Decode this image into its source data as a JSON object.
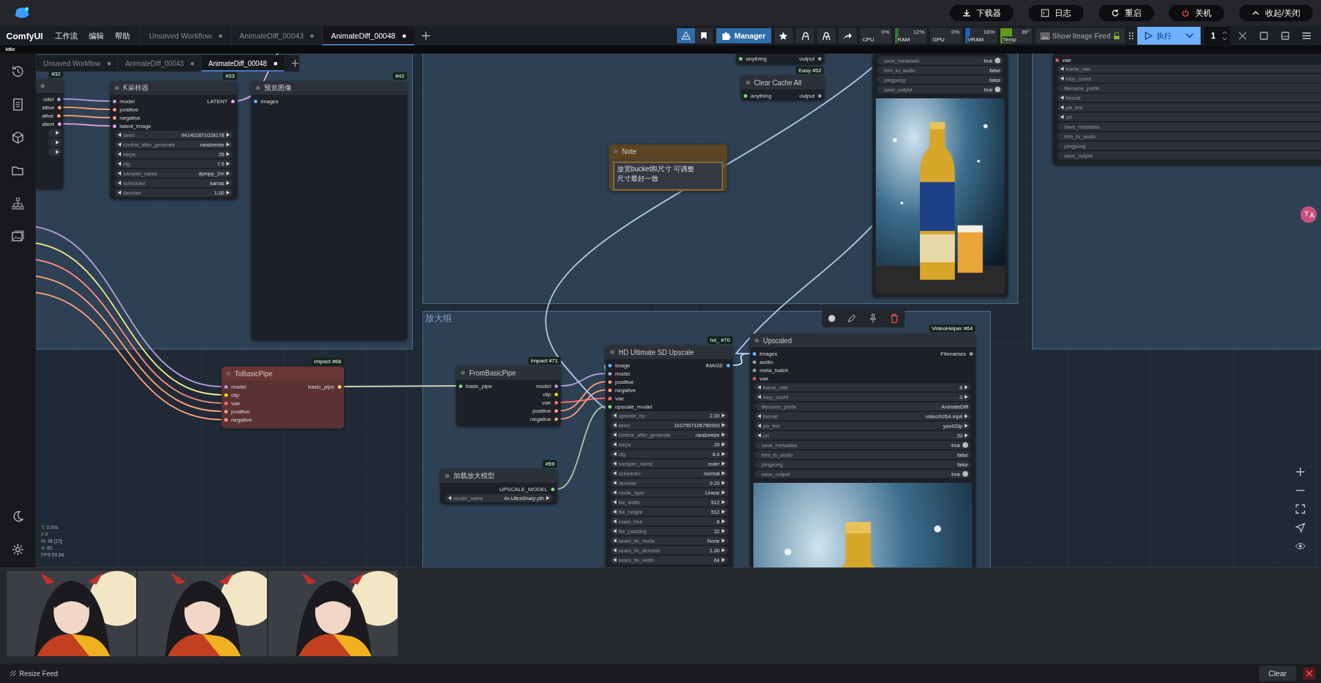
{
  "top_bar": {
    "buttons": [
      {
        "label": "下载器"
      },
      {
        "label": "日志"
      },
      {
        "label": "重启"
      },
      {
        "label": "关机"
      },
      {
        "label": "收起/关闭"
      }
    ]
  },
  "menu": {
    "brand": "ComfyUI",
    "items": [
      "工作流",
      "编辑",
      "帮助"
    ]
  },
  "workflow_tabs": [
    {
      "label": "Unsaved Workflow",
      "selected": false,
      "modified": true
    },
    {
      "label": "AnimateDiff_00043",
      "selected": false,
      "modified": true
    },
    {
      "label": "AnimateDiff_00048",
      "selected": true,
      "modified": true
    }
  ],
  "toolbar": {
    "manager_label": "Manager",
    "monitors": [
      {
        "name": "CPU",
        "reading": "0%"
      },
      {
        "name": "RAM",
        "reading": "12%",
        "level": 0.12,
        "color": "#2e7d32"
      },
      {
        "name": "GPU",
        "reading": "0%"
      },
      {
        "name": "VRAM",
        "reading": "16%",
        "level": 0.16,
        "color": "#1e63b8"
      },
      {
        "name": "Temp",
        "reading": "39°",
        "level": 0.39,
        "color": "#5f9a1c"
      }
    ],
    "image_feed_label": "Show Image Feed",
    "run_label": "执行",
    "queue_count": "1"
  },
  "status": "Idle",
  "canvas_tabs": [
    {
      "label": "Unsaved Workflow",
      "selected": false,
      "modified": true
    },
    {
      "label": "AnimateDiff_00043",
      "selected": false,
      "modified": true
    },
    {
      "label": "AnimateDiff_00048",
      "selected": true,
      "modified": true
    }
  ],
  "group_title": "放大组",
  "nodes": [
    {
      "kind": "node",
      "badge": "#32",
      "outputs": [
        {
          "name": "odel",
          "color": "#b39ddb"
        },
        {
          "name": "sitive",
          "color": "#ffa07a"
        },
        {
          "name": "ative",
          "color": "#ffa07a"
        },
        {
          "name": "atent",
          "color": "#ff9cf9"
        }
      ],
      "widgets": [
        {
          "kind": "stub"
        },
        {
          "kind": "stub"
        },
        {
          "kind": "stub"
        }
      ]
    },
    {
      "kind": "node",
      "title": "K采样器",
      "badge": "#33",
      "inputs": [
        {
          "name": "model",
          "color": "#b39ddb"
        },
        {
          "name": "positive",
          "color": "#ffa07a"
        },
        {
          "name": "negative",
          "color": "#ffa07a"
        },
        {
          "name": "latent_image",
          "color": "#ff9cf9"
        }
      ],
      "outputs": [
        {
          "name": "LATENT",
          "color": "#ff9cf9"
        }
      ],
      "widgets": [
        {
          "kind": "combo",
          "name": "seed",
          "value": "941402871028178"
        },
        {
          "kind": "combo",
          "name": "control_after_generate",
          "value": "randomize"
        },
        {
          "kind": "combo",
          "name": "steps",
          "value": "25"
        },
        {
          "kind": "combo",
          "name": "cfg",
          "value": "7.5"
        },
        {
          "kind": "combo",
          "name": "sampler_name",
          "value": "dpmpp_2m"
        },
        {
          "kind": "combo",
          "name": "scheduler",
          "value": "karras"
        },
        {
          "kind": "combo",
          "name": "denoise",
          "value": "1.00"
        }
      ]
    },
    {
      "kind": "node",
      "title": "预览图像",
      "badge": "#42",
      "inputs": [
        {
          "name": "images",
          "color": "#64b5f6"
        }
      ]
    },
    {
      "kind": "node",
      "inputs": [
        {
          "name": "anything",
          "color": "#7ddf7d"
        }
      ],
      "outputs": [
        {
          "name": "output",
          "color": "#9e9e9e"
        }
      ]
    },
    {
      "kind": "node",
      "title": "Clear Cache All",
      "badge": "Easy #52",
      "inputs": [
        {
          "name": "anything",
          "color": "#7ddf7d"
        }
      ],
      "outputs": [
        {
          "name": "output",
          "color": "#9e9e9e"
        }
      ]
    },
    {
      "kind": "note",
      "title": "Note",
      "color": "#5c4322",
      "lines": [
        "放宽bucket和尺寸 可调整",
        "尺寸最好一致"
      ]
    },
    {
      "kind": "node",
      "widgets": [
        {
          "kind": "toggle",
          "name": "save_metadata",
          "value": "true",
          "on": true
        },
        {
          "kind": "toggle",
          "name": "trim_to_audio",
          "value": "false",
          "on": false
        },
        {
          "kind": "toggle",
          "name": "pingpong",
          "value": "false",
          "on": false
        },
        {
          "kind": "toggle",
          "name": "save_output",
          "value": "true",
          "on": true
        }
      ],
      "picture": {
        "kind": "picture"
      }
    },
    {
      "kind": "node",
      "inputs": [
        {
          "name": "vae",
          "color": "#e05555"
        }
      ],
      "widgets": [
        {
          "kind": "combo",
          "name": "frame_rate"
        },
        {
          "kind": "combo",
          "name": "loop_count"
        },
        {
          "kind": "text",
          "name": "filename_prefix"
        },
        {
          "kind": "combo",
          "name": "format"
        },
        {
          "kind": "combo",
          "name": "pix_fmt"
        },
        {
          "kind": "combo",
          "name": "crf"
        },
        {
          "kind": "toggle",
          "name": "save_metadata"
        },
        {
          "kind": "toggle",
          "name": "trim_to_audio"
        },
        {
          "kind": "toggle",
          "name": "pingpong"
        },
        {
          "kind": "toggle",
          "name": "save_output"
        }
      ]
    },
    {
      "kind": "node",
      "title": "ToBasicPipe",
      "badge": "Impact #68",
      "color": "#6a3434",
      "inputs": [
        {
          "name": "model",
          "color": "#b39ddb"
        },
        {
          "name": "clip",
          "color": "#ffd500"
        },
        {
          "name": "vae",
          "color": "#ff6e6e"
        },
        {
          "name": "positive",
          "color": "#ffa07a"
        },
        {
          "name": "negative",
          "color": "#ffa07a"
        }
      ],
      "outputs": [
        {
          "name": "basic_pipe",
          "color": "#e6e67a"
        }
      ]
    },
    {
      "kind": "node",
      "title": "FromBasicPipe",
      "badge": "Impact #71",
      "inputs": [
        {
          "name": "basic_pipe",
          "color": "#7ddf7d"
        }
      ],
      "outputs": [
        {
          "name": "model",
          "color": "#b39ddb"
        },
        {
          "name": "clip",
          "color": "#ffd500"
        },
        {
          "name": "vae",
          "color": "#ff6e6e"
        },
        {
          "name": "positive",
          "color": "#ffa07a"
        },
        {
          "name": "negative",
          "color": "#ffa07a"
        }
      ]
    },
    {
      "kind": "node",
      "title": "加载放大模型",
      "badge": "#59",
      "outputs": [
        {
          "name": "UPSCALE_MODEL",
          "color": "#7ddf7d"
        }
      ],
      "widgets": [
        {
          "kind": "combo",
          "name": "model_name",
          "value": "4x-UltraSharp.pth"
        }
      ]
    },
    {
      "kind": "node",
      "title": "HD Ultimate SD Upscale",
      "badge": "hd_ #70",
      "inputs": [
        {
          "name": "image",
          "color": "#64b5f6"
        },
        {
          "name": "model",
          "color": "#b39ddb"
        },
        {
          "name": "positive",
          "color": "#ffa07a"
        },
        {
          "name": "negative",
          "color": "#ffa07a"
        },
        {
          "name": "vae",
          "color": "#ff6e6e"
        },
        {
          "name": "upscale_model",
          "color": "#7ddf7d"
        }
      ],
      "outputs": [
        {
          "name": "IMAGE",
          "color": "#64b5f6"
        }
      ],
      "widgets": [
        {
          "kind": "combo",
          "name": "upscale_by",
          "value": "2.00"
        },
        {
          "kind": "combo",
          "name": "seed",
          "value": "1107597105750993"
        },
        {
          "kind": "combo",
          "name": "control_after_generate",
          "value": "randomize"
        },
        {
          "kind": "combo",
          "name": "steps",
          "value": "20"
        },
        {
          "kind": "combo",
          "name": "cfg",
          "value": "8.0"
        },
        {
          "kind": "combo",
          "name": "sampler_name",
          "value": "euler"
        },
        {
          "kind": "combo",
          "name": "scheduler",
          "value": "normal"
        },
        {
          "kind": "combo",
          "name": "denoise",
          "value": "0.20"
        },
        {
          "kind": "combo",
          "name": "mode_type",
          "value": "Linear"
        },
        {
          "kind": "combo",
          "name": "tile_width",
          "value": "512"
        },
        {
          "kind": "combo",
          "name": "tile_height",
          "value": "512"
        },
        {
          "kind": "combo",
          "name": "mask_blur",
          "value": "8"
        },
        {
          "kind": "combo",
          "name": "tile_padding",
          "value": "32"
        },
        {
          "kind": "combo",
          "name": "seam_fix_mode",
          "value": "None"
        },
        {
          "kind": "combo",
          "name": "seam_fix_denoise",
          "value": "1.00"
        },
        {
          "kind": "combo",
          "name": "seam_fix_width",
          "value": "64"
        }
      ]
    },
    {
      "kind": "node",
      "title": "Upscaled",
      "badge": "VideoHelper #64",
      "inputs": [
        {
          "name": "images",
          "color": "#64b5f6"
        },
        {
          "name": "audio",
          "color": "#9e9e9e"
        },
        {
          "name": "meta_batch",
          "color": "#9e9e9e"
        },
        {
          "name": "vae",
          "color": "#e05555"
        }
      ],
      "outputs": [
        {
          "name": "Filenames",
          "color": "#9e9e9e"
        }
      ],
      "widgets": [
        {
          "kind": "combo",
          "name": "frame_rate",
          "value": "8"
        },
        {
          "kind": "combo",
          "name": "loop_count",
          "value": "0"
        },
        {
          "kind": "text",
          "name": "filename_prefix",
          "value": "AnimateDiff"
        },
        {
          "kind": "combo",
          "name": "format",
          "value": "video/h264-mp4"
        },
        {
          "kind": "combo",
          "name": "pix_fmt",
          "value": "yuv420p"
        },
        {
          "kind": "combo",
          "name": "crf",
          "value": "20"
        },
        {
          "kind": "toggle",
          "name": "save_metadata",
          "value": "true",
          "on": true
        },
        {
          "kind": "toggle",
          "name": "trim_to_audio",
          "value": "false",
          "on": false
        },
        {
          "kind": "toggle",
          "name": "pingpong",
          "value": "false",
          "on": false
        },
        {
          "kind": "toggle",
          "name": "save_output",
          "value": "true",
          "on": true
        }
      ],
      "picture": {
        "kind": "picture"
      }
    }
  ],
  "stats": [
    "T: 0.00s",
    "I: 0",
    "N: 36 [15]",
    "V: 80",
    "FPS:59.88"
  ],
  "feed": {
    "images": [
      {
        "kind": "picture"
      },
      {
        "kind": "picture"
      },
      {
        "kind": "picture"
      }
    ]
  },
  "footer": {
    "resize_label": "Resize Feed",
    "clear_label": "Clear"
  }
}
